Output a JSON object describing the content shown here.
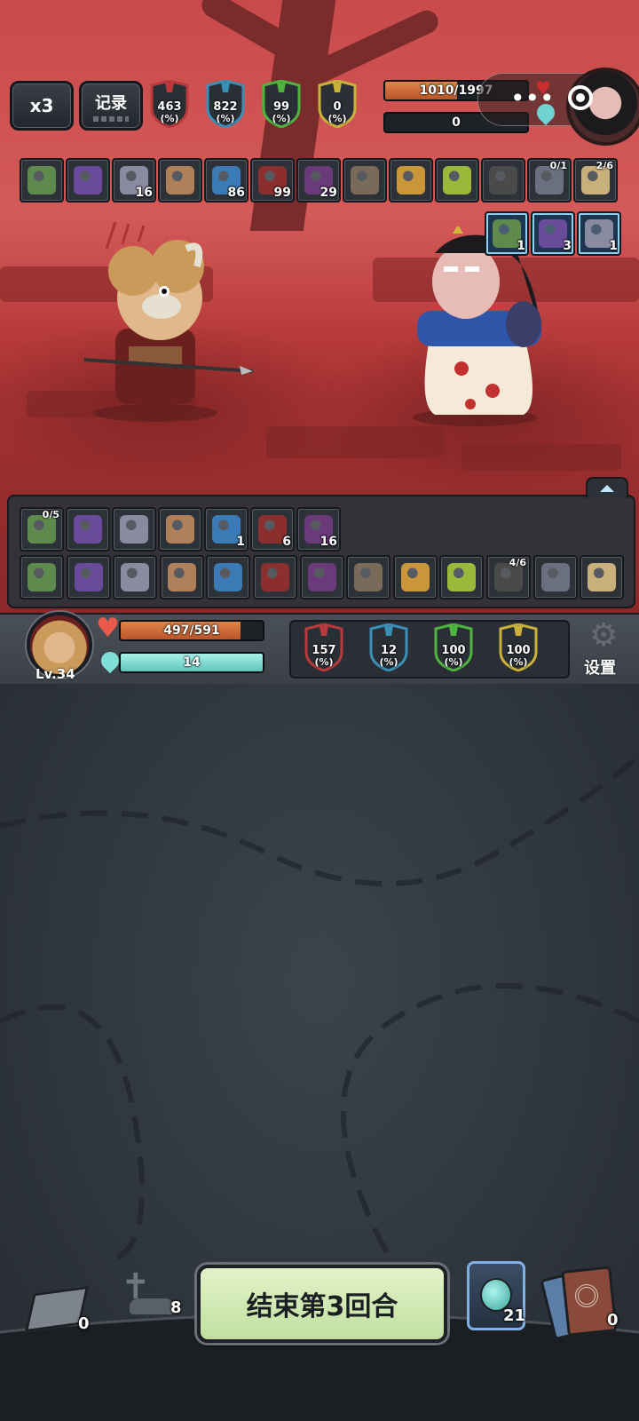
{
  "topbar": {
    "speed_label": "x3",
    "log_label": "记录",
    "enemy_stats": [
      {
        "value": "463",
        "unit": "(%)",
        "color": "#b83a3a"
      },
      {
        "value": "822",
        "unit": "(%)",
        "color": "#3a8fb5"
      },
      {
        "value": "99",
        "unit": "(%)",
        "color": "#4fb340"
      },
      {
        "value": "0",
        "unit": "(%)",
        "color": "#c9b23a"
      }
    ],
    "enemy_hp_text": "1010/1997",
    "enemy_hp_fraction": 0.506,
    "enemy_shield_text": "0",
    "enemy_shield_fraction": 0
  },
  "enemy_items": [
    {
      "icon": "green-potion-icon",
      "count": ""
    },
    {
      "icon": "purple-gem-icon",
      "count": ""
    },
    {
      "icon": "swirl-icon",
      "count": "16"
    },
    {
      "icon": "crystal-icon",
      "count": ""
    },
    {
      "icon": "blue-shield-icon",
      "count": "86"
    },
    {
      "icon": "claw-icon",
      "count": "99"
    },
    {
      "icon": "hooded-figure-icon",
      "count": "29"
    },
    {
      "icon": "book-icon",
      "count": ""
    },
    {
      "icon": "monster-icon",
      "count": ""
    },
    {
      "icon": "bone-icon",
      "count": ""
    },
    {
      "icon": "dagger-icon",
      "count": ""
    },
    {
      "icon": "knight-icon",
      "top_count": "0/1"
    },
    {
      "icon": "scroll-icon",
      "top_count": "2/6"
    }
  ],
  "enemy_effects": [
    {
      "icon": "target-icon",
      "count": "1"
    },
    {
      "icon": "snowflake-icon",
      "count": "3"
    },
    {
      "icon": "lightning-icon",
      "count": "1"
    }
  ],
  "player_items_row1": [
    {
      "icon": "ring-icon",
      "top_count": "0/5"
    },
    {
      "icon": "helmet-icon",
      "count": ""
    },
    {
      "icon": "armor-icon",
      "count": ""
    },
    {
      "icon": "blue-crystal-icon",
      "count": ""
    },
    {
      "icon": "sword-icon",
      "count": "1"
    },
    {
      "icon": "green-slime-icon",
      "count": "6"
    },
    {
      "icon": "swirl-icon",
      "count": "16"
    }
  ],
  "player_items_row2": [
    {
      "icon": "staff-icon",
      "count": ""
    },
    {
      "icon": "fish-icon",
      "count": ""
    },
    {
      "icon": "spear-icon",
      "count": ""
    },
    {
      "icon": "meat-icon",
      "count": ""
    },
    {
      "icon": "red-book-icon",
      "count": ""
    },
    {
      "icon": "helmet-icon",
      "count": ""
    },
    {
      "icon": "red-pipe-icon",
      "count": ""
    },
    {
      "icon": "broom-icon",
      "count": ""
    },
    {
      "icon": "glasses-icon",
      "count": ""
    },
    {
      "icon": "mask-icon",
      "count": ""
    },
    {
      "icon": "scroll-icon",
      "top_count": "4/6"
    },
    {
      "icon": "gauntlet-icon",
      "count": ""
    },
    {
      "icon": "knife-icon",
      "count": ""
    }
  ],
  "player": {
    "level": "Lv.34",
    "hp_text": "497/591",
    "hp_fraction": 0.841,
    "mana_text": "14",
    "mana_fraction": 1.0,
    "stats": [
      {
        "value": "157",
        "unit": "(%)",
        "color": "#b83a3a"
      },
      {
        "value": "12",
        "unit": "(%)",
        "color": "#3a8fb5"
      },
      {
        "value": "100",
        "unit": "(%)",
        "color": "#4fb340"
      },
      {
        "value": "100",
        "unit": "(%)",
        "color": "#c9b23a"
      }
    ],
    "settings_label": "设置"
  },
  "bottom": {
    "draw_pile_count": "0",
    "graveyard_count": "8",
    "end_turn_label": "结束第3回合",
    "potion_count": "21",
    "discard_pile_count": "0"
  }
}
